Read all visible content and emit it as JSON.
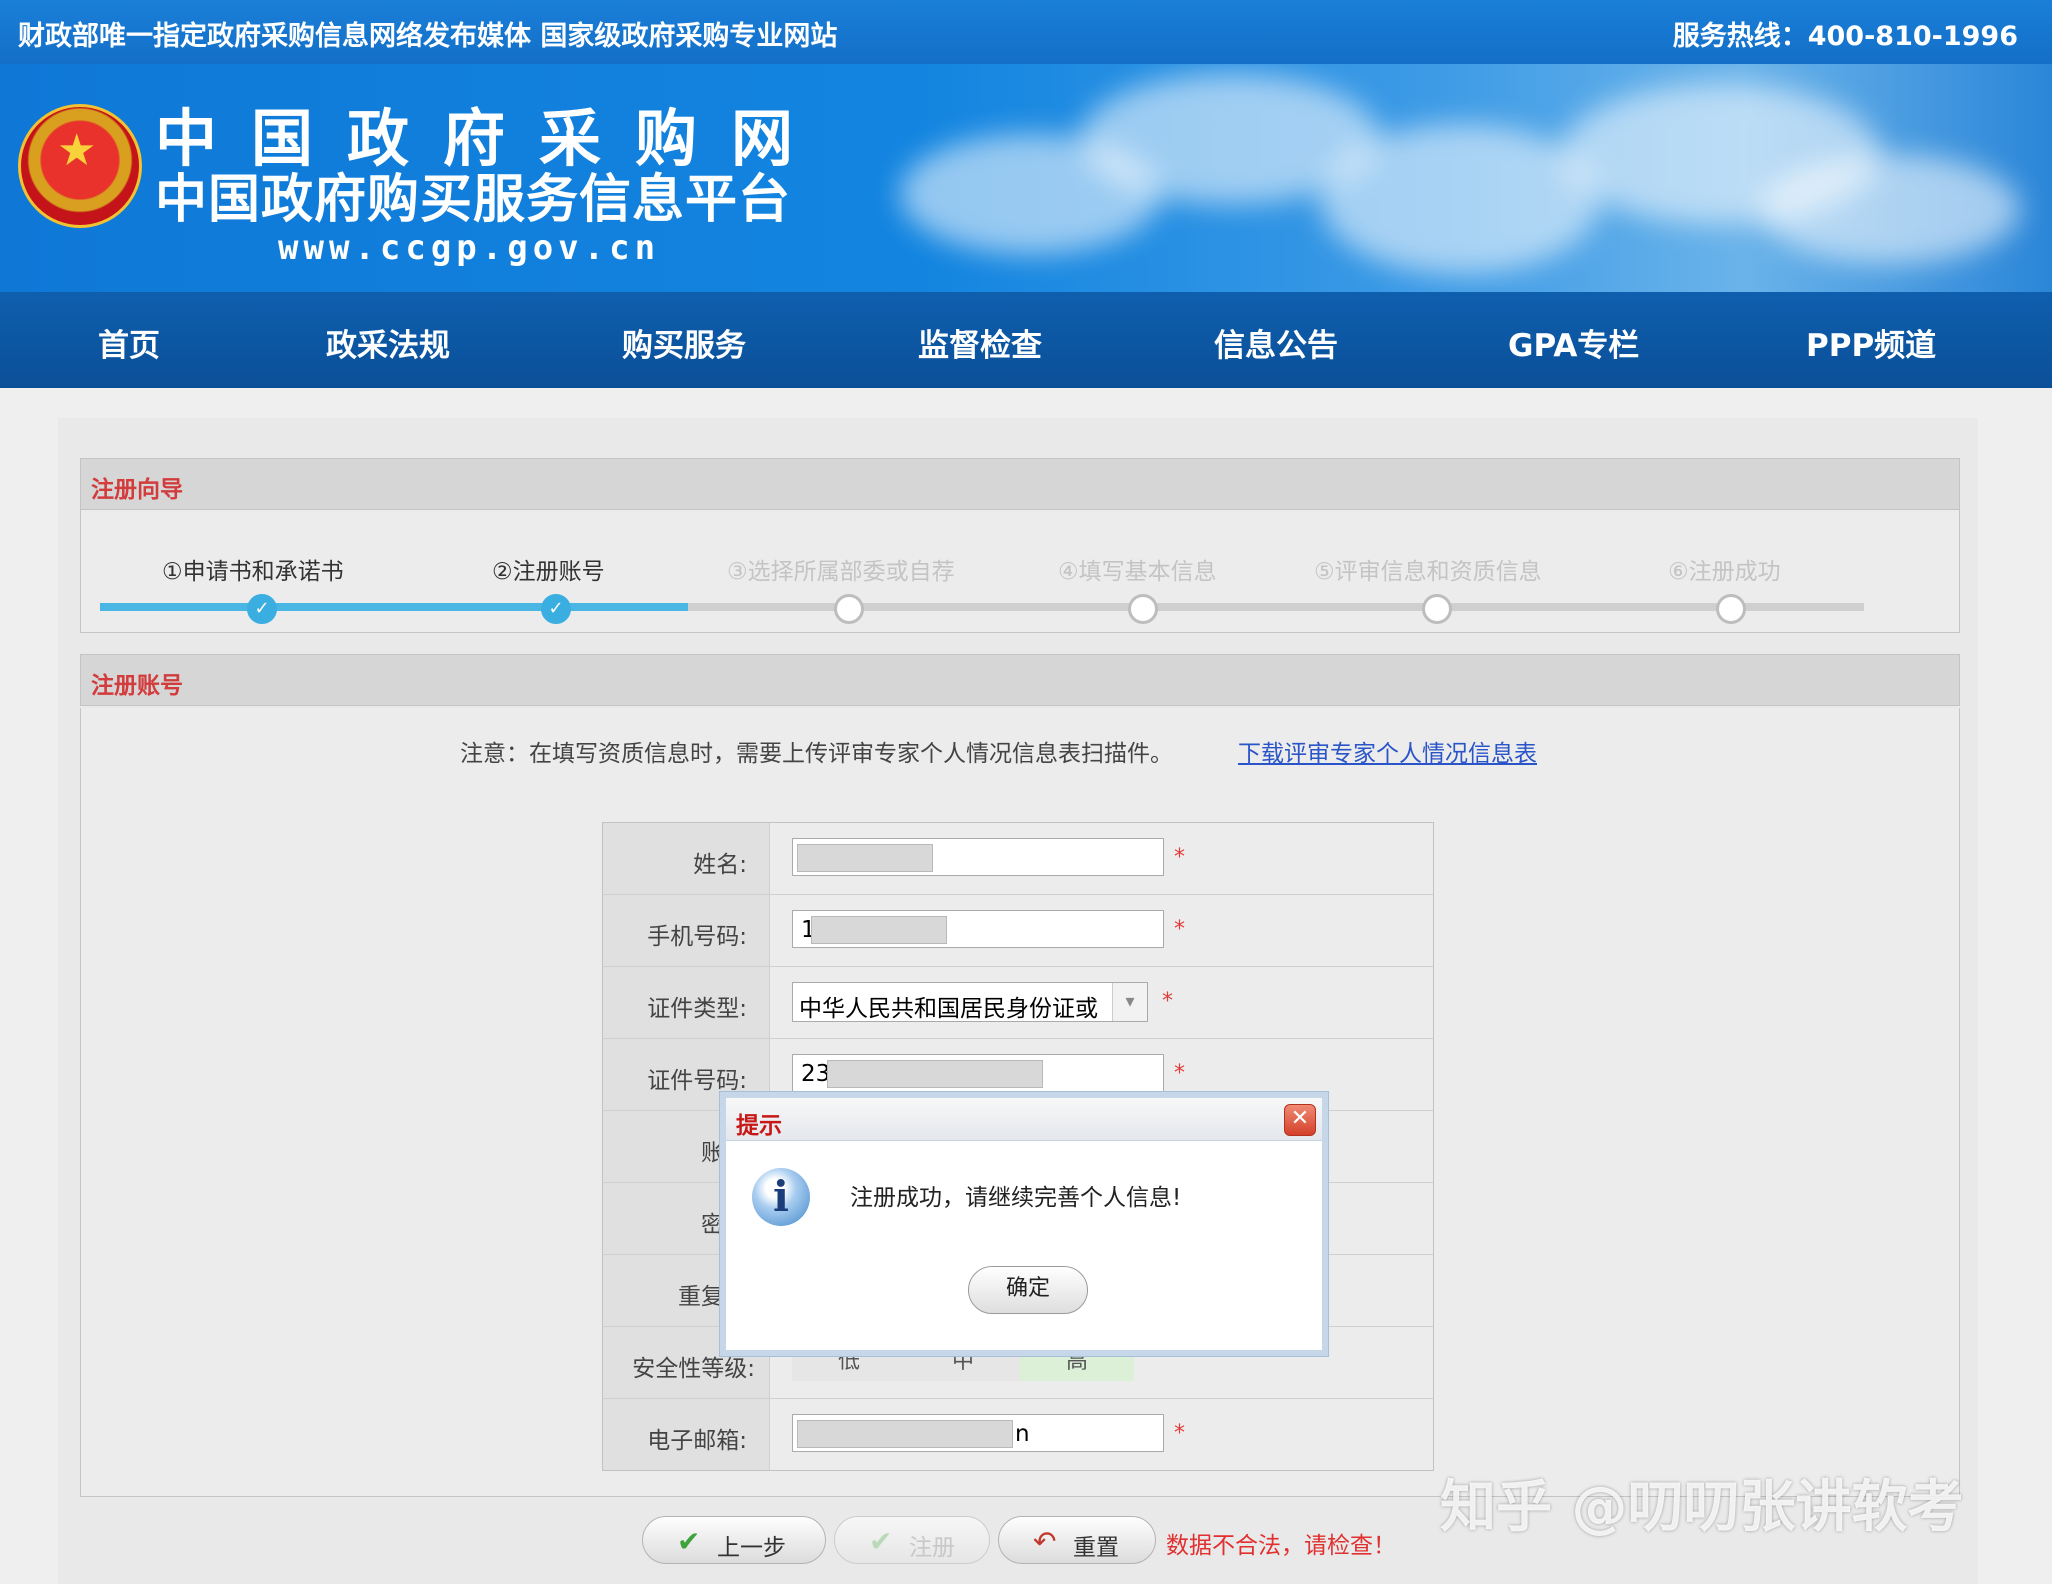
{
  "topbar": {
    "slogan": "财政部唯一指定政府采购信息网络发布媒体 国家级政府采购专业网站",
    "hotline": "服务热线：400-810-1996"
  },
  "header": {
    "title": "中国政府采购网",
    "subtitle": "中国政府购买服务信息平台",
    "url": "www.ccgp.gov.cn"
  },
  "nav": {
    "items": [
      "首页",
      "政采法规",
      "购买服务",
      "监督检查",
      "信息公告",
      "GPA专栏",
      "PPP频道"
    ]
  },
  "wizard": {
    "heading": "注册向导",
    "steps": [
      "①申请书和承诺书",
      "②注册账号",
      "③选择所属部委或自荐",
      "④填写基本信息",
      "⑤评审信息和资质信息",
      "⑥注册成功"
    ],
    "completed_steps": 2
  },
  "account": {
    "heading": "注册账号",
    "notice": "注意：在填写资质信息时，需要上传评审专家个人情况信息表扫描件。",
    "download_link": "下载评审专家个人情况信息表"
  },
  "form": {
    "name_label": "姓名:",
    "phone_label": "手机号码:",
    "phone_value": "1",
    "idtype_label": "证件类型:",
    "idtype_value": "中华人民共和国居民身份证或",
    "idnum_label": "证件号码:",
    "idnum_value": "23",
    "account_label": "账号",
    "password_label": "密码",
    "repeat_label": "重复密",
    "strength_label": "安全性等级:",
    "strength_levels": [
      "低",
      "中",
      "高"
    ],
    "email_label": "电子邮箱:",
    "email_value": "n",
    "required_mark": "*"
  },
  "buttons": {
    "prev": "上一步",
    "register": "注册",
    "reset": "重置"
  },
  "error_text": "数据不合法，请检查！",
  "dialog": {
    "title": "提示",
    "message": "注册成功，请继续完善个人信息!",
    "ok": "确定"
  },
  "watermark": "知乎 @叨叨张讲软考"
}
